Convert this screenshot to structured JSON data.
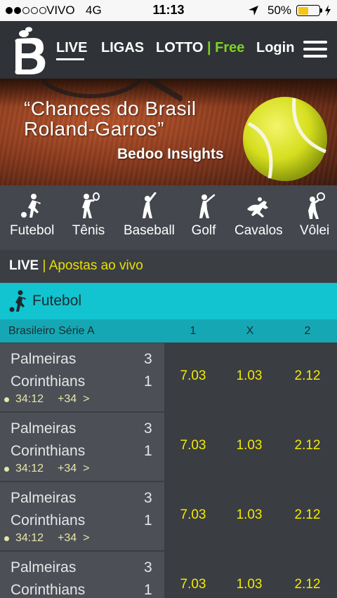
{
  "status_bar": {
    "carrier": "VIVO",
    "network": "4G",
    "time": "11:13",
    "battery_percent": "50%",
    "battery_level": 0.5,
    "signal_bars_filled": 2,
    "signal_bars_total": 5
  },
  "nav": {
    "items": [
      {
        "label": "LIVE",
        "active": true
      },
      {
        "label": "LIGAS"
      },
      {
        "label": "LOTTO"
      }
    ],
    "lotto_separator": "|",
    "lotto_badge": "Free",
    "login_label": "Login",
    "accent_color": "#7ed321"
  },
  "banner": {
    "title": "“Chances do Brasil Roland-Garros”",
    "subtitle": "Bedoo Insights"
  },
  "sports": [
    {
      "label": "Futebol",
      "icon": "soccer-player-icon"
    },
    {
      "label": "Tênis",
      "icon": "tennis-player-icon"
    },
    {
      "label": "Baseball",
      "icon": "baseball-player-icon"
    },
    {
      "label": "Golf",
      "icon": "golf-player-icon"
    },
    {
      "label": "Cavalos",
      "icon": "horse-racing-icon"
    },
    {
      "label": "Vôlei",
      "icon": "volleyball-player-icon"
    }
  ],
  "live_bar": {
    "title": "LIVE",
    "separator": "|",
    "subtitle": "Apostas ao vivo"
  },
  "section": {
    "title": "Futebol",
    "color": "#12c3d0"
  },
  "league": {
    "name": "Brasileiro Série A",
    "columns": [
      "1",
      "X",
      "2"
    ]
  },
  "matches": [
    {
      "home": "Palmeiras",
      "away": "Corinthians",
      "home_score": "3",
      "away_score": "1",
      "clock": "34:12",
      "more": "+34",
      "chevron": ">",
      "odds": [
        "7.03",
        "1.03",
        "2.12"
      ]
    },
    {
      "home": "Palmeiras",
      "away": "Corinthians",
      "home_score": "3",
      "away_score": "1",
      "clock": "34:12",
      "more": "+34",
      "chevron": ">",
      "odds": [
        "7.03",
        "1.03",
        "2.12"
      ]
    },
    {
      "home": "Palmeiras",
      "away": "Corinthians",
      "home_score": "3",
      "away_score": "1",
      "clock": "34:12",
      "more": "+34",
      "chevron": ">",
      "odds": [
        "7.03",
        "1.03",
        "2.12"
      ]
    },
    {
      "home": "Palmeiras",
      "away": "Corinthians",
      "home_score": "3",
      "away_score": "1",
      "odds": [
        "7.03",
        "1.03",
        "2.12"
      ]
    }
  ]
}
